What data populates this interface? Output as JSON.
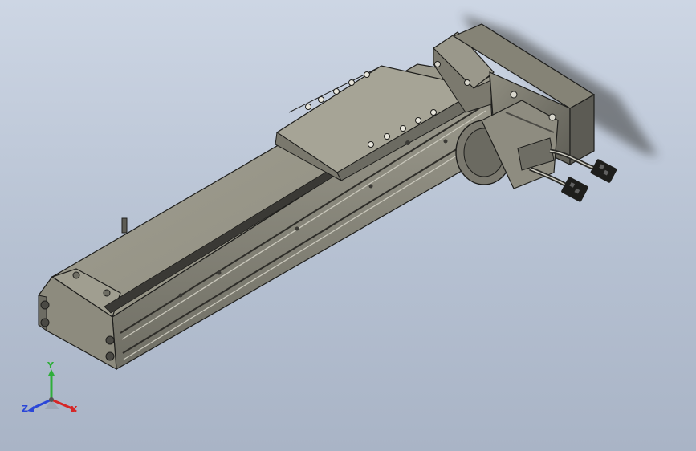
{
  "viewport": {
    "background_top": "#cdd6e4",
    "background_bottom": "#a9b4c6"
  },
  "model": {
    "body_light": "#9c9a8c",
    "body_mid": "#7f7d71",
    "body_dark": "#55544d",
    "rail_color": "#b3b1a6",
    "edge_color": "#1e1e1c"
  },
  "triad": {
    "y_label": "Y",
    "z_label": "Z",
    "x_label": "X",
    "y_color": "#2fae3a",
    "z_color": "#2a46d8",
    "x_color": "#d62626",
    "icon": "axis-triad-icon"
  }
}
